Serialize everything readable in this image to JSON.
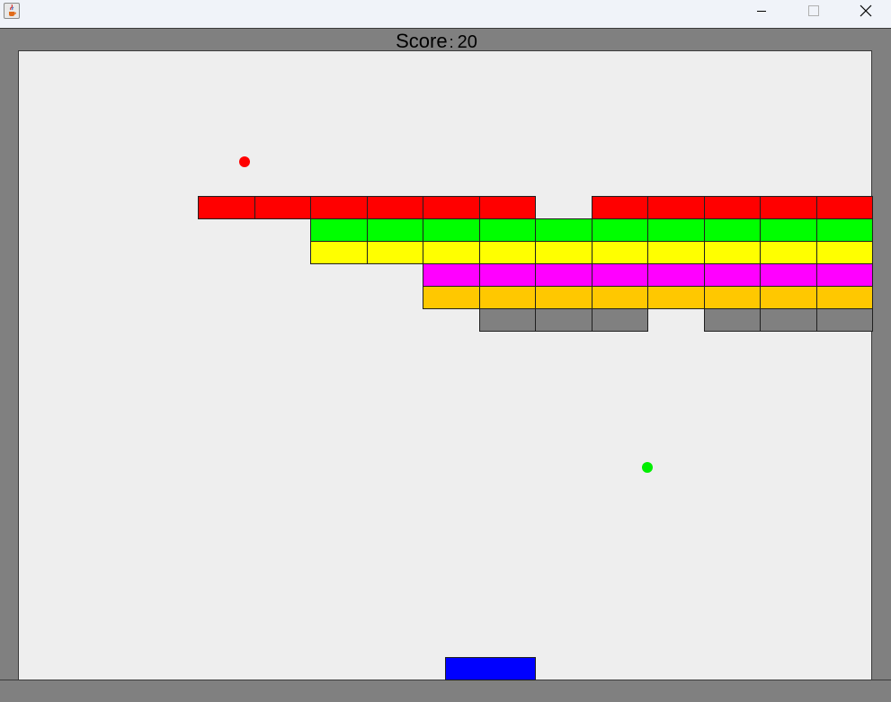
{
  "window": {
    "title": "",
    "icon": "java-cup-icon",
    "controls": [
      "minimize-icon",
      "maximize-icon",
      "close-icon"
    ]
  },
  "hud": {
    "score_label": "Score",
    "score_separator": ":",
    "score_value": "20"
  },
  "colors": {
    "frame": "#808080",
    "playfield": "#eeeeee",
    "paddle": "#0000ff",
    "ball_red": "#ff0000",
    "ball_green": "#00ee00",
    "brick_border": "#202020"
  },
  "bricks": {
    "rows": [
      {
        "color": "#ff0000",
        "present": [
          1,
          1,
          1,
          1,
          1,
          1,
          0,
          1,
          1,
          1,
          1,
          1
        ]
      },
      {
        "color": "#00ff00",
        "present": [
          0,
          0,
          1,
          1,
          1,
          1,
          1,
          1,
          1,
          1,
          1,
          1
        ]
      },
      {
        "color": "#ffff00",
        "present": [
          0,
          0,
          1,
          1,
          1,
          1,
          1,
          1,
          1,
          1,
          1,
          1
        ]
      },
      {
        "color": "#ff00ff",
        "present": [
          0,
          0,
          0,
          0,
          1,
          1,
          1,
          1,
          1,
          1,
          1,
          1
        ]
      },
      {
        "color": "#ffc800",
        "present": [
          0,
          0,
          0,
          0,
          1,
          1,
          1,
          1,
          1,
          1,
          1,
          1
        ]
      },
      {
        "color": "#808080",
        "present": [
          0,
          0,
          0,
          0,
          0,
          1,
          1,
          1,
          0,
          1,
          1,
          1
        ]
      }
    ]
  },
  "balls": [
    {
      "name": "red-ball",
      "color": "#ff0000"
    },
    {
      "name": "green-ball",
      "color": "#00ee00"
    }
  ]
}
